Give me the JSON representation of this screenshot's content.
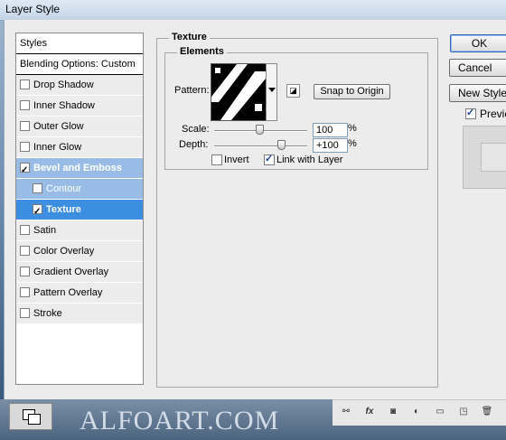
{
  "window": {
    "title": "Layer Style"
  },
  "styles_panel": {
    "header": "Styles",
    "blending_options": "Blending Options: Custom",
    "items": [
      {
        "label": "Drop Shadow",
        "checked": false
      },
      {
        "label": "Inner Shadow",
        "checked": false
      },
      {
        "label": "Outer Glow",
        "checked": false
      },
      {
        "label": "Inner Glow",
        "checked": false
      },
      {
        "label": "Bevel and Emboss",
        "checked": true
      },
      {
        "label": "Contour",
        "checked": false
      },
      {
        "label": "Texture",
        "checked": true
      },
      {
        "label": "Satin",
        "checked": false
      },
      {
        "label": "Color Overlay",
        "checked": false
      },
      {
        "label": "Gradient Overlay",
        "checked": false
      },
      {
        "label": "Pattern Overlay",
        "checked": false
      },
      {
        "label": "Stroke",
        "checked": false
      }
    ]
  },
  "texture": {
    "group_label": "Texture",
    "elements_label": "Elements",
    "pattern_label": "Pattern:",
    "snap_button": "Snap to Origin",
    "scale_label": "Scale:",
    "scale_value": "100",
    "scale_unit": "%",
    "depth_label": "Depth:",
    "depth_value": "+100",
    "depth_unit": "%",
    "invert_label": "Invert",
    "invert_checked": false,
    "link_label": "Link with Layer",
    "link_checked": true
  },
  "actions": {
    "ok": "OK",
    "cancel": "Cancel",
    "new_style": "New Style...",
    "preview_label": "Preview",
    "preview_checked": true
  },
  "watermark": "ALFOART.COM",
  "colors": {
    "selected_parent": "#99bce6",
    "selected_active": "#3c8fe0",
    "dialog_bg": "#ececec"
  }
}
